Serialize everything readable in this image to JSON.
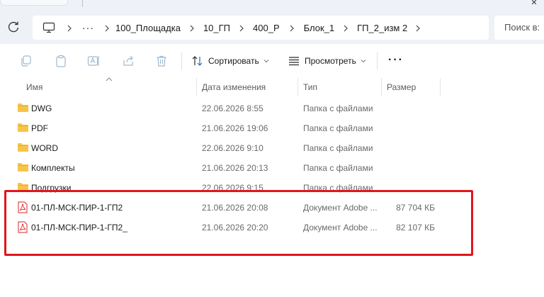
{
  "window": {
    "close_glyph": "✕"
  },
  "nav": {
    "refresh_icon": "refresh-icon",
    "computer_icon": "computer-icon",
    "overflow": "···",
    "breadcrumbs": [
      "100_Площадка",
      "10_ГП",
      "400_Р",
      "Блок_1",
      "ГП_2_изм 2"
    ],
    "search_placeholder": "Поиск в:"
  },
  "toolbar": {
    "sort_label": "Сортировать",
    "view_label": "Просмотреть",
    "more_label": "···"
  },
  "columns": {
    "name": "Имя",
    "date": "Дата изменения",
    "type": "Тип",
    "size": "Размер"
  },
  "files": [
    {
      "name": "DWG",
      "date": "22.06.2026 8:55",
      "type": "Папка с файлами",
      "size": "",
      "kind": "folder"
    },
    {
      "name": "PDF",
      "date": "21.06.2026 19:06",
      "type": "Папка с файлами",
      "size": "",
      "kind": "folder"
    },
    {
      "name": "WORD",
      "date": "22.06.2026 9:10",
      "type": "Папка с файлами",
      "size": "",
      "kind": "folder"
    },
    {
      "name": "Комплекты",
      "date": "21.06.2026 20:13",
      "type": "Папка с файлами",
      "size": "",
      "kind": "folder"
    },
    {
      "name": "Подгрузки",
      "date": "22.06.2026 9:15",
      "type": "Папка с файлами",
      "size": "",
      "kind": "folder"
    },
    {
      "name": "01-ПЛ-МСК-ПИР-1-ГП2",
      "date": "21.06.2026 20:08",
      "type": "Документ Adobe ...",
      "size": "87 704 КБ",
      "kind": "pdf"
    },
    {
      "name": "01-ПЛ-МСК-ПИР-1-ГП2_",
      "date": "21.06.2026 20:20",
      "type": "Документ Adobe ...",
      "size": "82 107 КБ",
      "kind": "pdf"
    }
  ],
  "colors": {
    "folder": "#f7c44a",
    "pdf": "#d9262b",
    "highlight": "#e0161b",
    "chrome": "#eef2f7"
  }
}
